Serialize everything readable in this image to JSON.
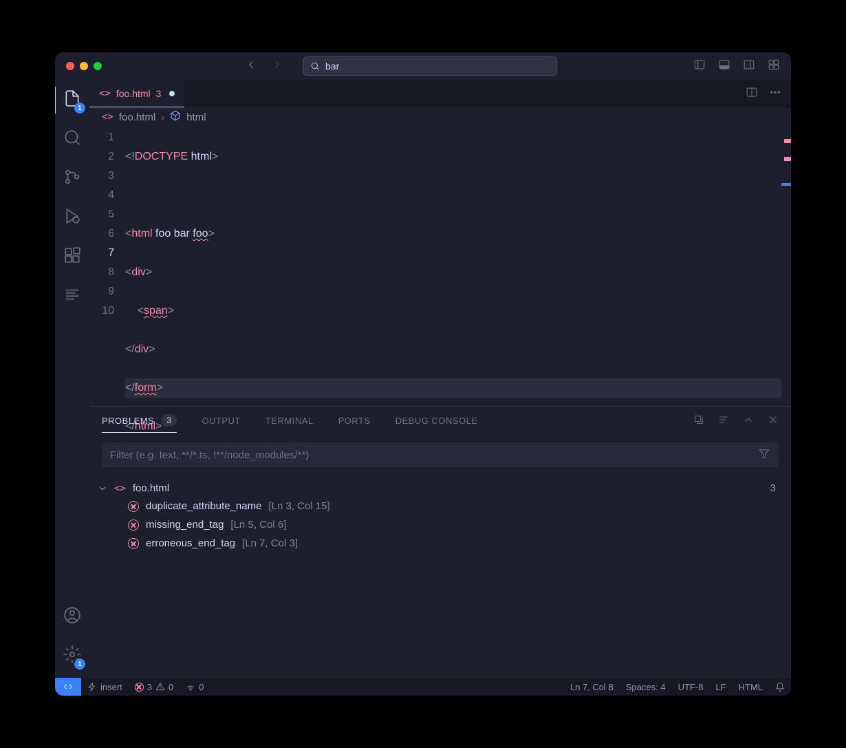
{
  "titlebar": {
    "search": "bar"
  },
  "activitybar": {
    "explorer_badge": "1",
    "settings_badge": "1"
  },
  "tab": {
    "filename": "foo.html",
    "problems": "3"
  },
  "breadcrumb": {
    "file": "foo.html",
    "symbol": "html"
  },
  "editor": {
    "lines": [
      {
        "n": "1"
      },
      {
        "n": "2"
      },
      {
        "n": "3"
      },
      {
        "n": "4"
      },
      {
        "n": "5"
      },
      {
        "n": "6"
      },
      {
        "n": "7"
      },
      {
        "n": "8"
      },
      {
        "n": "9"
      },
      {
        "n": "10"
      }
    ],
    "l1": {
      "p1": "<!",
      "kw": "DOCTYPE",
      "sp": " ",
      "attr": "html",
      "p2": ">"
    },
    "l3": {
      "p1": "<",
      "tag": "html",
      "a1": " foo bar ",
      "a2": "foo",
      "p2": ">"
    },
    "l4": {
      "p1": "<",
      "tag": "div",
      "p2": ">"
    },
    "l5": {
      "pad": "    ",
      "p1": "<",
      "tag": "span",
      "p2": ">"
    },
    "l6": {
      "p1": "</",
      "tag": "div",
      "p2": ">"
    },
    "l7": {
      "p1": "</",
      "tag": "form",
      "p2": ">"
    },
    "l8": {
      "p1": "</",
      "tag": "html",
      "p2": ">"
    }
  },
  "panel": {
    "tabs": {
      "problems": "PROBLEMS",
      "problems_count": "3",
      "output": "OUTPUT",
      "terminal": "TERMINAL",
      "ports": "PORTS",
      "debug": "DEBUG CONSOLE"
    },
    "filter_placeholder": "Filter (e.g. text, **/*.ts, !**/node_modules/**)",
    "file": {
      "name": "foo.html",
      "count": "3"
    },
    "items": [
      {
        "msg": "duplicate_attribute_name",
        "loc": "[Ln 3, Col 15]"
      },
      {
        "msg": "missing_end_tag",
        "loc": "[Ln 5, Col 6]"
      },
      {
        "msg": "erroneous_end_tag",
        "loc": "[Ln 7, Col 3]"
      }
    ]
  },
  "statusbar": {
    "insert": "insert",
    "err": "3",
    "warn": "0",
    "port": "0",
    "pos": "Ln 7, Col 8",
    "spaces": "Spaces: 4",
    "enc": "UTF-8",
    "eol": "LF",
    "lang": "HTML"
  }
}
